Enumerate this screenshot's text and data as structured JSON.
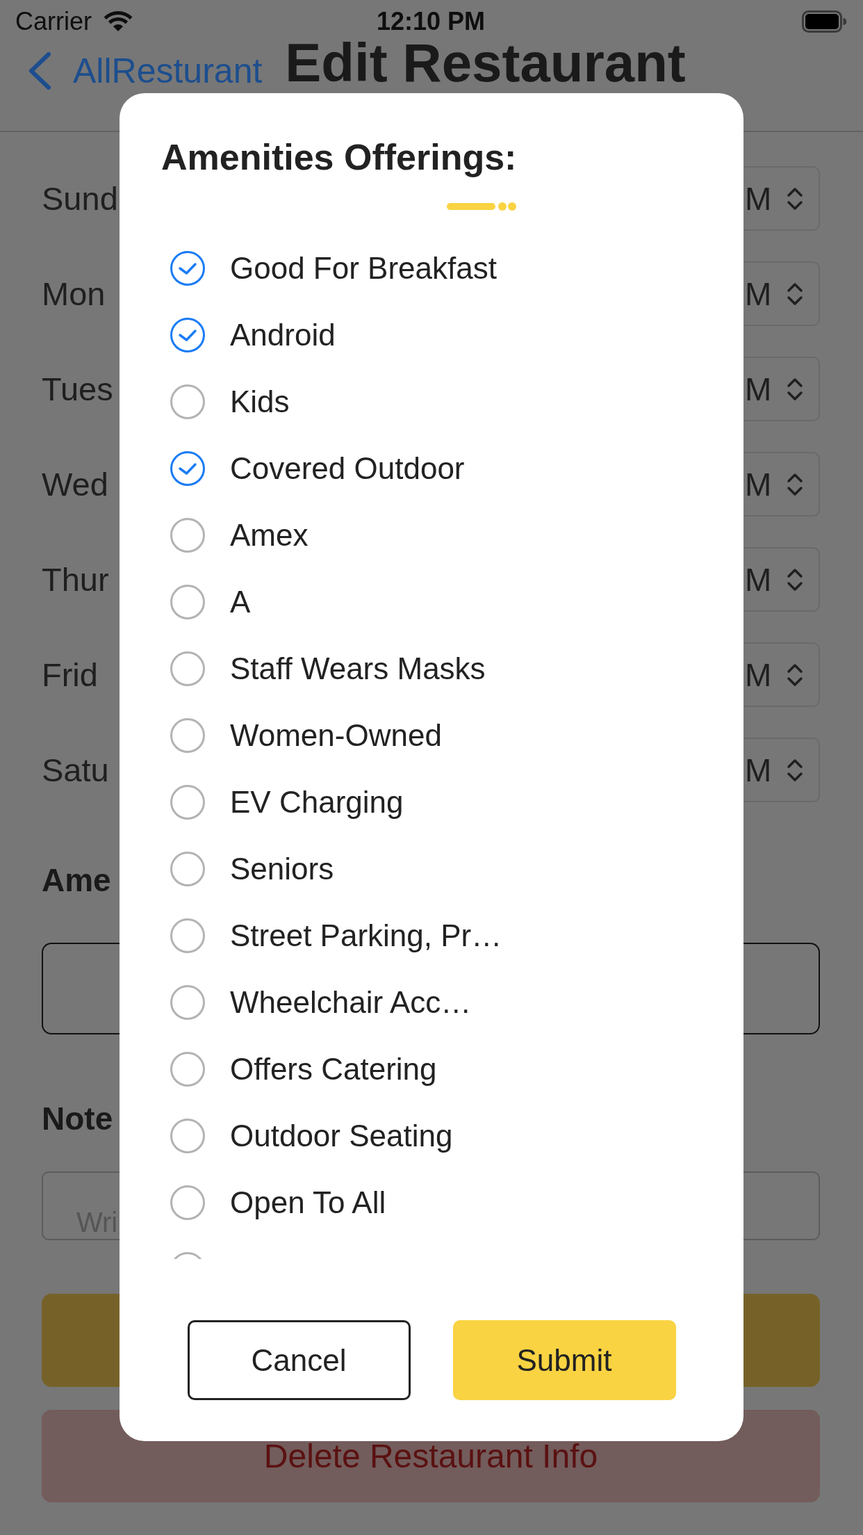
{
  "status_bar": {
    "carrier": "Carrier",
    "time": "12:10 PM"
  },
  "nav_bar": {
    "back_label": "AllResturant",
    "title": "Edit Restaurant"
  },
  "schedule": [
    {
      "day": "Sund",
      "time": "M"
    },
    {
      "day": "Mon",
      "time": "M"
    },
    {
      "day": "Tues",
      "time": "M"
    },
    {
      "day": "Wed",
      "time": "M"
    },
    {
      "day": "Thur",
      "time": "M"
    },
    {
      "day": "Frid",
      "time": "M"
    },
    {
      "day": "Satu",
      "time": "M"
    }
  ],
  "amenities_section": {
    "heading": "Ame"
  },
  "notes_section": {
    "heading": "Note",
    "placeholder": "Wri"
  },
  "page_buttons": [
    {
      "kind": "primary"
    },
    {
      "kind": "destructive",
      "label": "Delete Restaurant Info"
    }
  ],
  "dialog": {
    "title": "Amenities Offerings:",
    "options": [
      {
        "label": "Good For Breakfast",
        "checked": true
      },
      {
        "label": "Android",
        "checked": true
      },
      {
        "label": "Kids",
        "checked": false
      },
      {
        "label": "Covered Outdoor",
        "checked": true
      },
      {
        "label": "Amex",
        "checked": false
      },
      {
        "label": "A",
        "checked": false
      },
      {
        "label": "Staff Wears Masks",
        "checked": false
      },
      {
        "label": "Women-Owned",
        "checked": false
      },
      {
        "label": "EV Charging",
        "checked": false
      },
      {
        "label": "Seniors",
        "checked": false
      },
      {
        "label": "Street Parking, Pr…",
        "checked": false
      },
      {
        "label": "Wheelchair Acc…",
        "checked": false
      },
      {
        "label": "Offers Catering",
        "checked": false
      },
      {
        "label": "Outdoor Seating",
        "checked": false
      },
      {
        "label": "Open To All",
        "checked": false
      },
      {
        "checked": false
      }
    ],
    "buttons": [
      {
        "label": "Cancel",
        "kind": "secondary"
      },
      {
        "label": "Submit",
        "kind": "primary"
      }
    ]
  }
}
